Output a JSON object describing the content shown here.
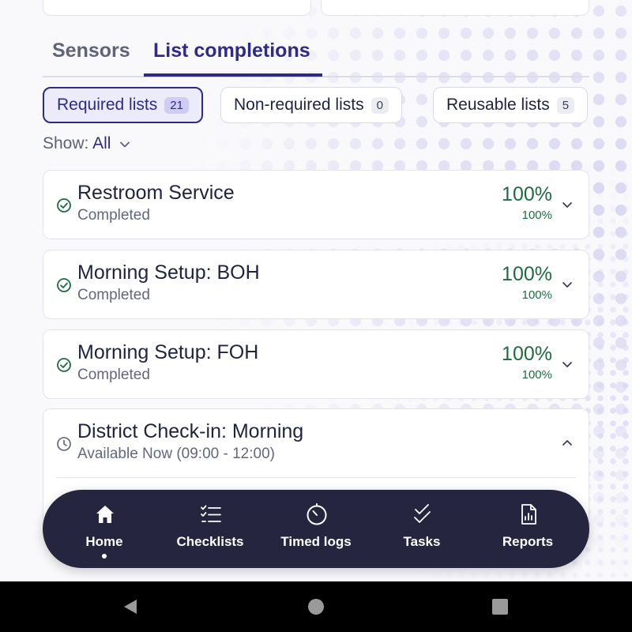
{
  "tabs": [
    {
      "label": "Sensors",
      "active": false
    },
    {
      "label": "List completions",
      "active": true
    }
  ],
  "filters": [
    {
      "label": "Required lists",
      "count": "21",
      "active": true
    },
    {
      "label": "Non-required lists",
      "count": "0",
      "active": false
    },
    {
      "label": "Reusable lists",
      "count": "5",
      "active": false
    }
  ],
  "show": {
    "label": "Show:",
    "value": "All"
  },
  "lists": [
    {
      "title": "Restroom Service",
      "subtitle": "Completed",
      "percent_main": "100%",
      "percent_sub": "100%",
      "status_icon": "check-circle-icon",
      "expanded": false
    },
    {
      "title": "Morning Setup: BOH",
      "subtitle": "Completed",
      "percent_main": "100%",
      "percent_sub": "100%",
      "status_icon": "check-circle-icon",
      "expanded": false
    },
    {
      "title": "Morning Setup: FOH",
      "subtitle": "Completed",
      "percent_main": "100%",
      "percent_sub": "100%",
      "status_icon": "check-circle-icon",
      "expanded": false
    },
    {
      "title": "District Check-in: Morning",
      "subtitle": "Available Now (09:00 - 12:00)",
      "status_icon": "clock-icon",
      "expanded": true
    }
  ],
  "nav": [
    {
      "label": "Home",
      "icon": "home-icon",
      "active": true
    },
    {
      "label": "Checklists",
      "icon": "checklist-icon",
      "active": false
    },
    {
      "label": "Timed logs",
      "icon": "timer-icon",
      "active": false
    },
    {
      "label": "Tasks",
      "icon": "double-check-icon",
      "active": false
    },
    {
      "label": "Reports",
      "icon": "report-icon",
      "active": false
    }
  ],
  "colors": {
    "accent": "#2e2a8a",
    "success": "#1e6b3e",
    "navbar": "#25253f"
  }
}
